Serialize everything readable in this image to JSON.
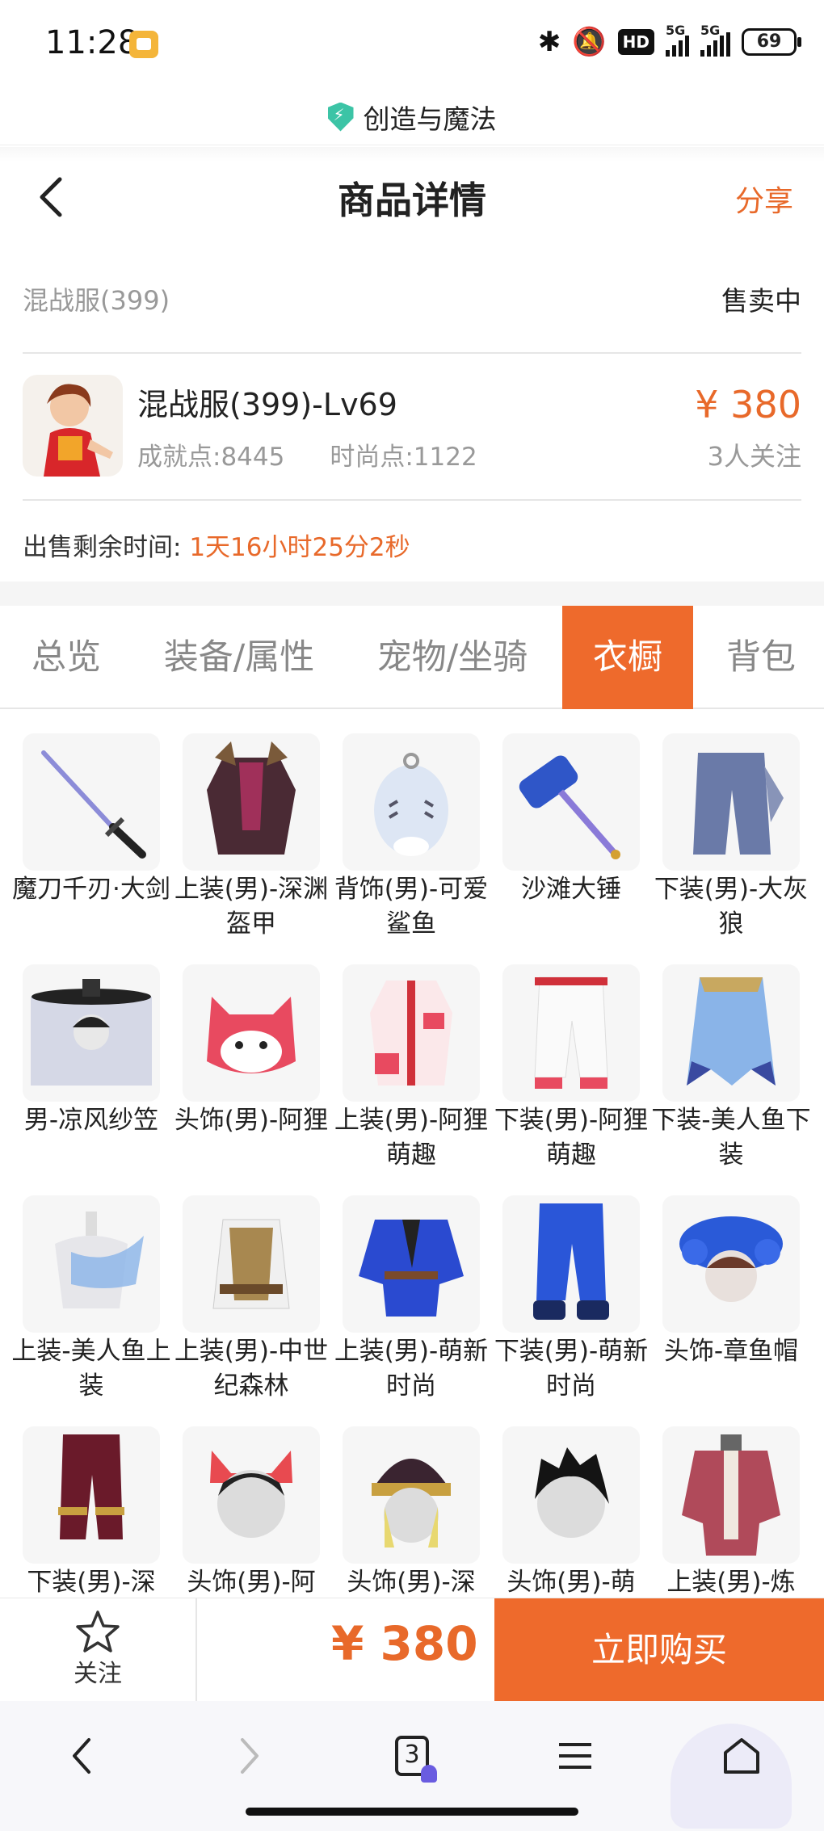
{
  "status_bar": {
    "time": "11:28",
    "network_1": "5G",
    "network_2": "5G",
    "hd_label": "HD",
    "battery": "69"
  },
  "mini_app": {
    "title": "创造与魔法"
  },
  "header": {
    "title": "商品详情",
    "share_label": "分享"
  },
  "listing": {
    "server": "混战服(399)",
    "status": "售卖中",
    "name": "混战服(399)-Lv69",
    "achievement_label": "成就点:8445",
    "fashion_label": "时尚点:1122",
    "price": "¥ 380",
    "watchers": "3人关注",
    "remain_label": "出售剩余时间:",
    "remain_value": "1天16小时25分2秒"
  },
  "tabs": [
    {
      "label": "总览",
      "active": false
    },
    {
      "label": "装备/属性",
      "active": false
    },
    {
      "label": "宠物/坐骑",
      "active": false
    },
    {
      "label": "衣橱",
      "active": true
    },
    {
      "label": "背包",
      "active": false
    }
  ],
  "wardrobe": [
    {
      "label": "魔刀千刃·大剑",
      "icon": "sword"
    },
    {
      "label": "上装(男)-深渊盔甲",
      "icon": "dark-armor"
    },
    {
      "label": "背饰(男)-可爱鲨鱼",
      "icon": "shark-backpack"
    },
    {
      "label": "沙滩大锤",
      "icon": "hammer"
    },
    {
      "label": "下装(男)-大灰狼",
      "icon": "grey-pants"
    },
    {
      "label": "男-凉风纱笠",
      "icon": "veil-hat"
    },
    {
      "label": "头饰(男)-阿狸",
      "icon": "fox-head"
    },
    {
      "label": "上装(男)-阿狸萌趣",
      "icon": "fox-jacket"
    },
    {
      "label": "下装(男)-阿狸萌趣",
      "icon": "white-pants"
    },
    {
      "label": "下装-美人鱼下装",
      "icon": "mermaid-tail"
    },
    {
      "label": "上装-美人鱼上装",
      "icon": "mermaid-top"
    },
    {
      "label": "上装(男)-中世纪森林",
      "icon": "forest-shirt"
    },
    {
      "label": "上装(男)-萌新时尚",
      "icon": "blue-robe"
    },
    {
      "label": "下装(男)-萌新时尚",
      "icon": "blue-pants"
    },
    {
      "label": "头饰-章鱼帽",
      "icon": "octopus-hat"
    },
    {
      "label": "下装(男)-深",
      "icon": "maroon-pants"
    },
    {
      "label": "头饰(男)-阿",
      "icon": "fox-ears-head"
    },
    {
      "label": "头饰(男)-深",
      "icon": "dark-helmet"
    },
    {
      "label": "头饰(男)-萌",
      "icon": "black-hair"
    },
    {
      "label": "上装(男)-炼",
      "icon": "alchemist-coat"
    }
  ],
  "action_bar": {
    "follow_label": "关注",
    "price": "¥ 380",
    "buy_label": "立即购买"
  },
  "browser_nav": {
    "tab_count": "3"
  },
  "colors": {
    "accent": "#ee6a2c",
    "price": "#e8692a"
  }
}
